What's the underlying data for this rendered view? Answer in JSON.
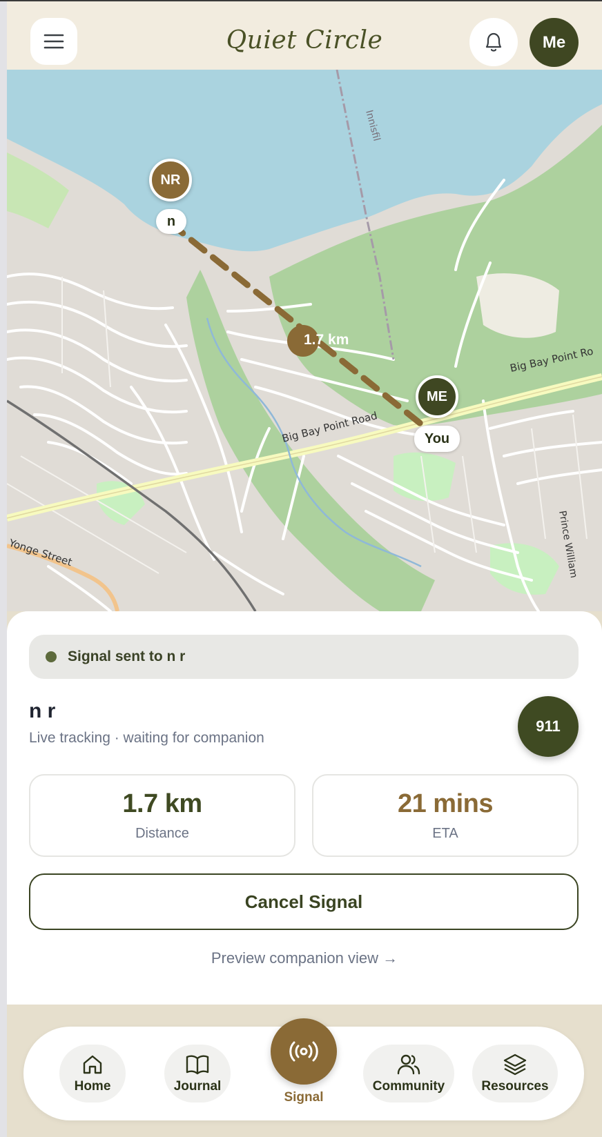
{
  "header": {
    "title": "Quiet Circle",
    "avatar_label": "Me"
  },
  "map": {
    "companion_initials": "NR",
    "companion_label": "n",
    "self_initials": "ME",
    "self_label": "You",
    "distance_label": "1.7 km",
    "street_labels": [
      "Big Bay Point Road",
      "Big Bay Point Ro",
      "Innisfil",
      "Yonge Street",
      "Prince William"
    ]
  },
  "status": {
    "text": "Signal sent to n r"
  },
  "contact": {
    "name": "n r",
    "subtitle": "Live tracking · waiting for companion",
    "emergency_label": "911"
  },
  "stats": {
    "distance_value": "1.7 km",
    "distance_label": "Distance",
    "eta_value": "21 mins",
    "eta_label": "ETA"
  },
  "actions": {
    "cancel_label": "Cancel Signal",
    "preview_label": "Preview companion view →"
  },
  "nav": {
    "items": [
      {
        "label": "Home"
      },
      {
        "label": "Journal"
      },
      {
        "label": "Signal"
      },
      {
        "label": "Community"
      },
      {
        "label": "Resources"
      }
    ]
  },
  "colors": {
    "olive": "#3f4722",
    "brown": "#8a6a36",
    "water": "#aad3df",
    "park": "#add19e"
  }
}
